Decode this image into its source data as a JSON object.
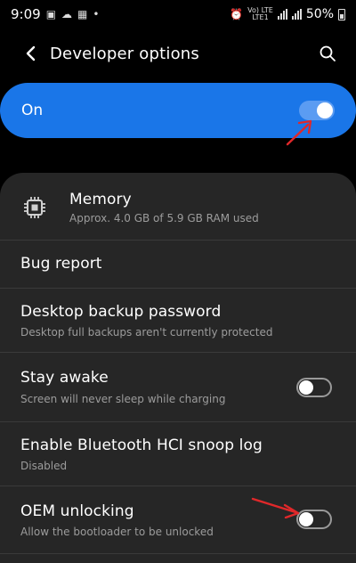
{
  "status_bar": {
    "time": "9:09",
    "network_top": "Vo) LTE",
    "network_bottom": "LTE1",
    "battery": "50%"
  },
  "app_bar": {
    "title": "Developer options"
  },
  "master_switch": {
    "label": "On",
    "state": "on"
  },
  "settings": [
    {
      "title": "Memory",
      "subtitle": "Approx. 4.0 GB of 5.9 GB RAM used"
    },
    {
      "title": "Bug report"
    },
    {
      "title": "Desktop backup password",
      "subtitle": "Desktop full backups aren't currently protected"
    },
    {
      "title": "Stay awake",
      "subtitle": "Screen will never sleep while charging",
      "toggle": "off"
    },
    {
      "title": "Enable Bluetooth HCI snoop log",
      "subtitle": "Disabled"
    },
    {
      "title": "OEM unlocking",
      "subtitle": "Allow the bootloader to be unlocked",
      "toggle": "off"
    }
  ],
  "colors": {
    "accent": "#1a76e8",
    "card": "#262626",
    "arrow": "#e0282a"
  }
}
